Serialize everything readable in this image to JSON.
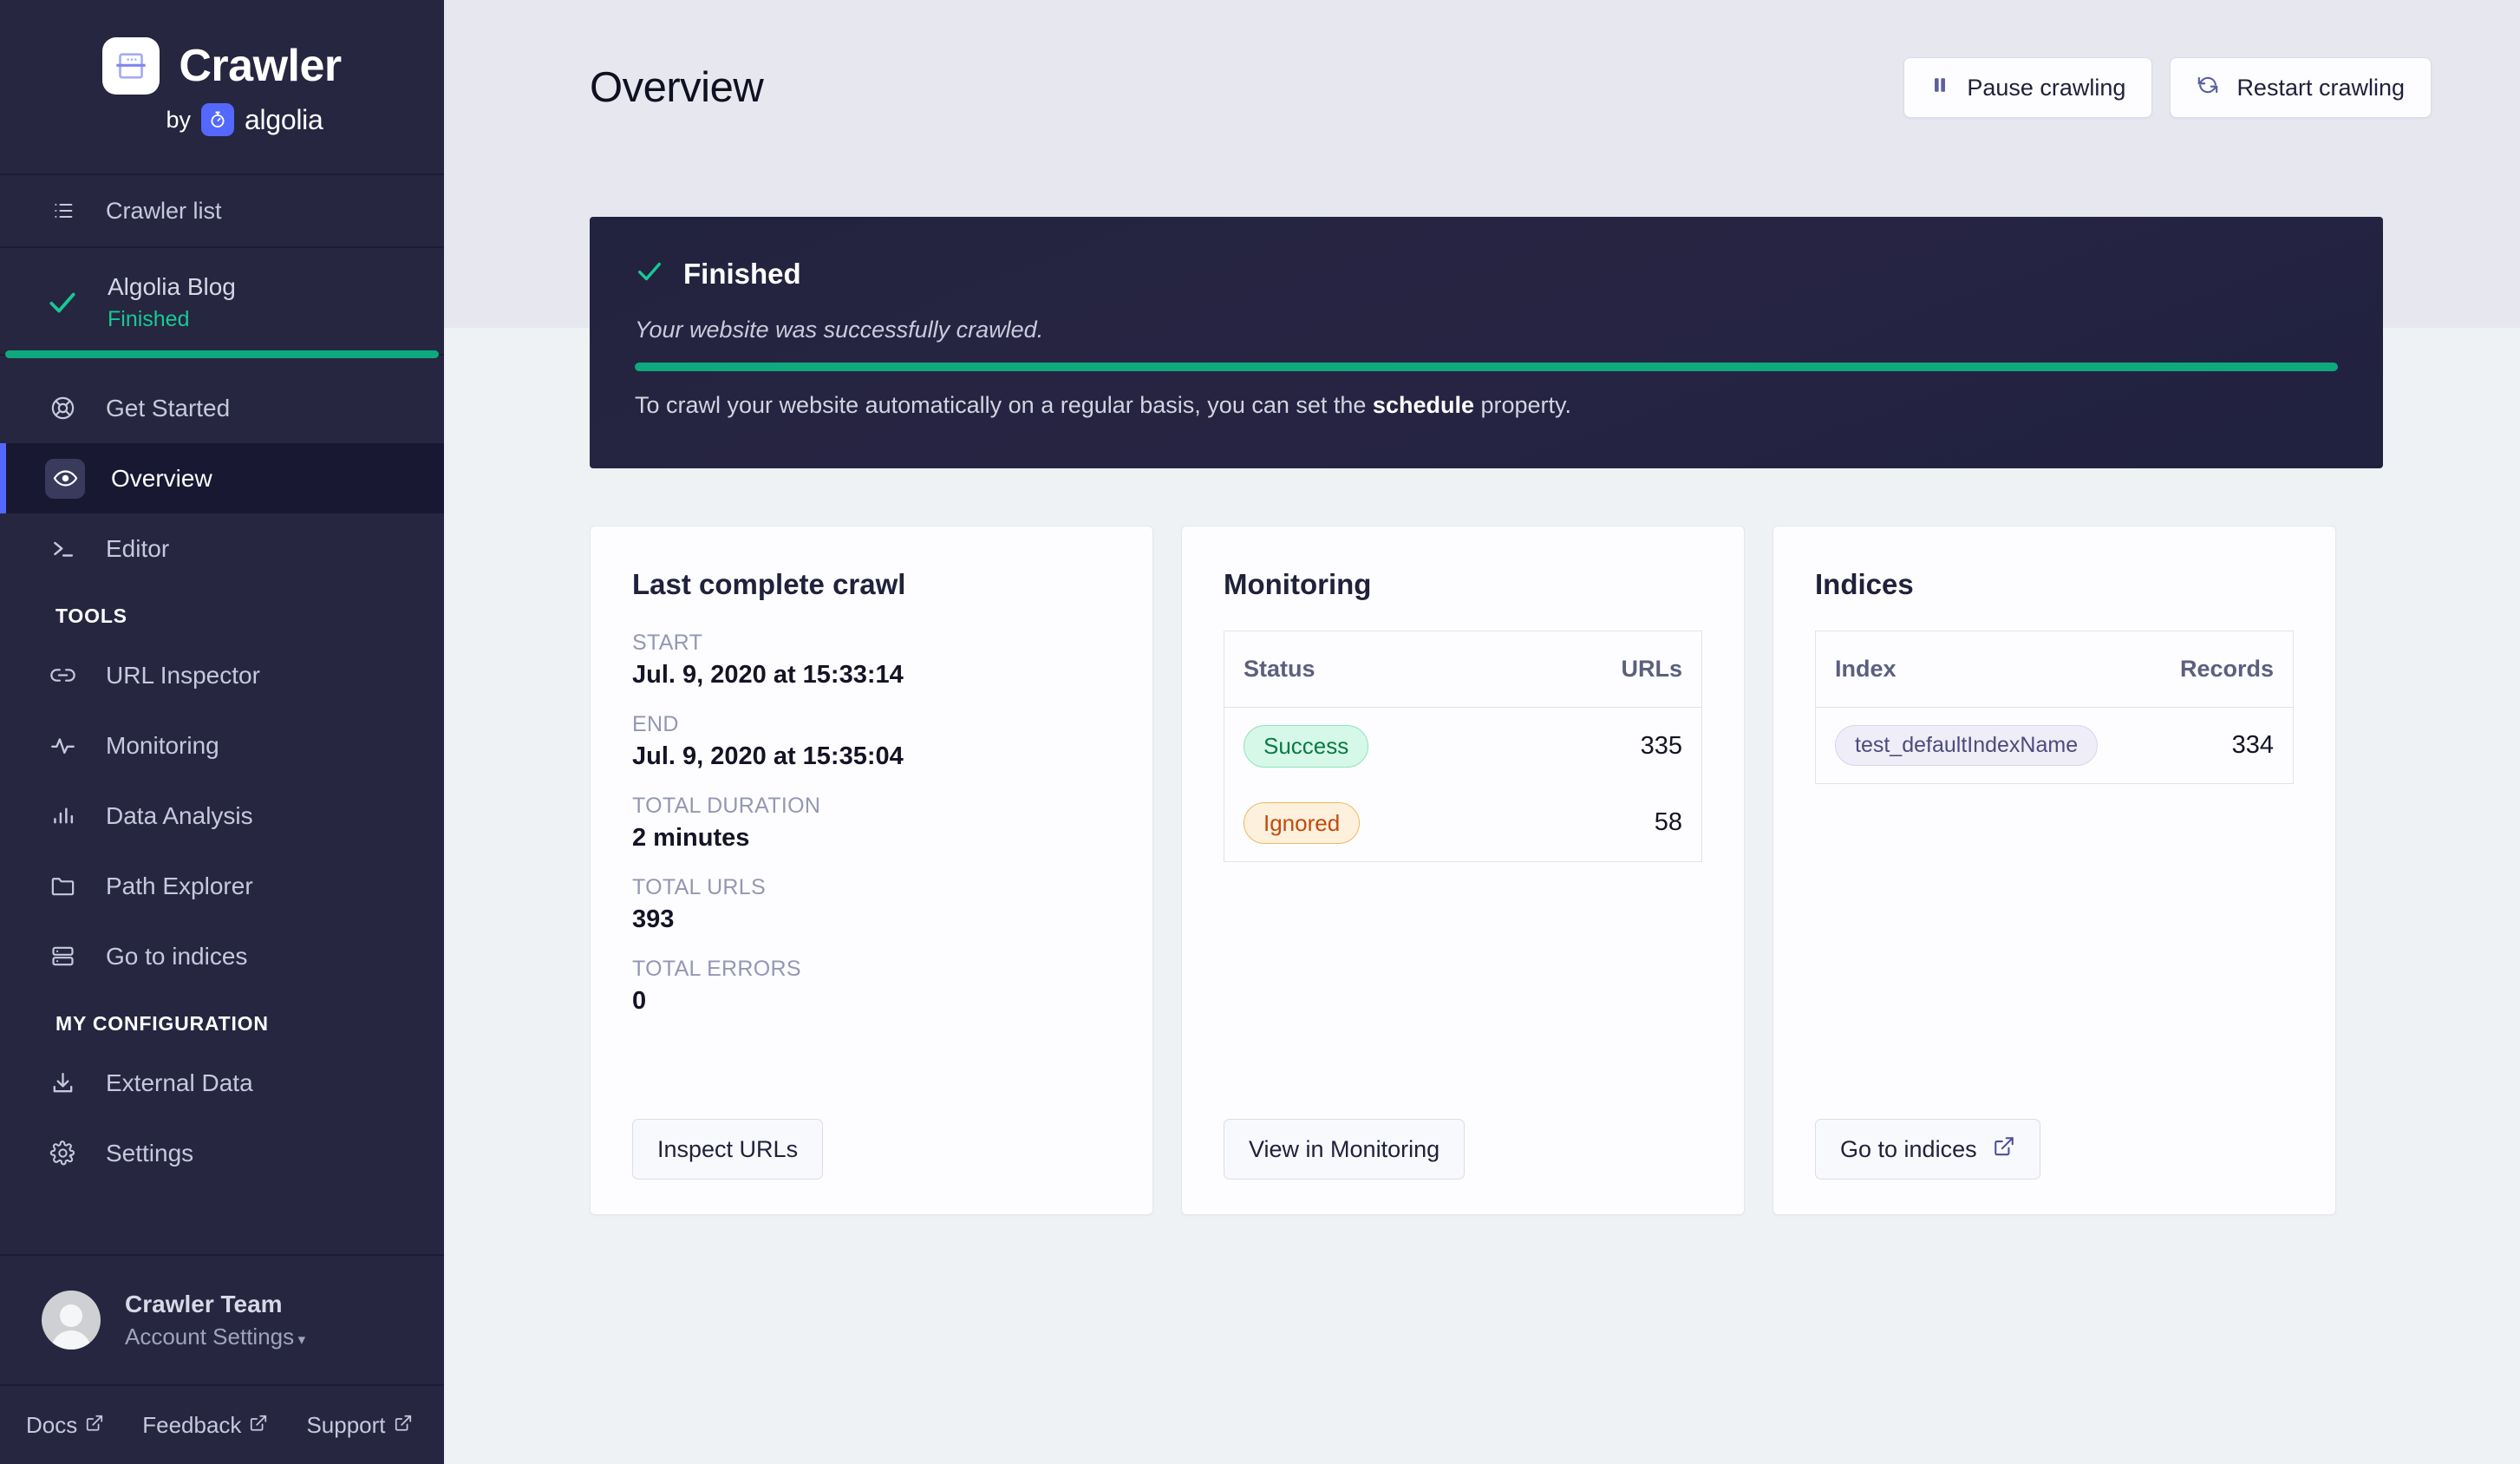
{
  "brand": {
    "name": "Crawler",
    "by": "by",
    "algolia": "algolia",
    "logo_icon": "browser-window-icon",
    "algolia_icon": "algolia-stopwatch-icon"
  },
  "sidebar": {
    "crawler_list": {
      "label": "Crawler list",
      "icon": "list-icon"
    },
    "current_crawler": {
      "title": "Algolia Blog",
      "status": "Finished",
      "check_icon": "check-icon",
      "progress_color": "#0fa97e"
    },
    "menu": [
      {
        "label": "Get Started",
        "icon": "lifebuoy-icon",
        "active": false
      },
      {
        "label": "Overview",
        "icon": "eye-icon",
        "active": true
      },
      {
        "label": "Editor",
        "icon": "terminal-icon",
        "active": false
      }
    ],
    "tools_heading": "TOOLS",
    "tools": [
      {
        "label": "URL Inspector",
        "icon": "link-icon"
      },
      {
        "label": "Monitoring",
        "icon": "activity-icon"
      },
      {
        "label": "Data Analysis",
        "icon": "bar-chart-icon"
      },
      {
        "label": "Path Explorer",
        "icon": "folder-icon"
      },
      {
        "label": "Go to indices",
        "icon": "database-icon"
      }
    ],
    "config_heading": "MY CONFIGURATION",
    "config": [
      {
        "label": "External Data",
        "icon": "download-icon"
      },
      {
        "label": "Settings",
        "icon": "gear-icon"
      }
    ],
    "account": {
      "name": "Crawler Team",
      "settings_label": "Account Settings",
      "caret": "▾",
      "avatar_icon": "avatar-icon"
    },
    "footer_links": [
      {
        "label": "Docs",
        "icon": "external-link-icon"
      },
      {
        "label": "Feedback",
        "icon": "external-link-icon"
      },
      {
        "label": "Support",
        "icon": "external-link-icon"
      }
    ]
  },
  "header": {
    "title": "Overview",
    "pause_button": {
      "label": "Pause crawling",
      "icon": "pause-icon"
    },
    "restart_button": {
      "label": "Restart crawling",
      "icon": "refresh-icon"
    }
  },
  "banner": {
    "status": "Finished",
    "check_icon": "check-icon",
    "message": "Your website was successfully crawled.",
    "note_before": "To crawl your website automatically on a regular basis, you can set the ",
    "note_link": "schedule",
    "note_after": " property.",
    "progress_percent": 100,
    "progress_color": "#0fa97e"
  },
  "cards": {
    "last_crawl": {
      "title": "Last complete crawl",
      "fields": [
        {
          "label": "START",
          "value": "Jul. 9, 2020 at 15:33:14"
        },
        {
          "label": "END",
          "value": "Jul. 9, 2020 at 15:35:04"
        },
        {
          "label": "TOTAL DURATION",
          "value": "2 minutes"
        },
        {
          "label": "TOTAL URLS",
          "value": "393"
        },
        {
          "label": "TOTAL ERRORS",
          "value": "0"
        }
      ],
      "button": {
        "label": "Inspect URLs",
        "icon": null
      }
    },
    "monitoring": {
      "title": "Monitoring",
      "columns": [
        "Status",
        "URLs"
      ],
      "rows": [
        {
          "status": "Success",
          "status_type": "success",
          "urls": "335"
        },
        {
          "status": "Ignored",
          "status_type": "ignored",
          "urls": "58"
        }
      ],
      "button": {
        "label": "View in Monitoring",
        "icon": null
      }
    },
    "indices": {
      "title": "Indices",
      "columns": [
        "Index",
        "Records"
      ],
      "rows": [
        {
          "index": "test_defaultIndexName",
          "records": "334"
        }
      ],
      "button": {
        "label": "Go to indices",
        "icon": "external-link-icon"
      }
    }
  },
  "colors": {
    "sidebar_bg": "#262640",
    "sidebar_active_bg": "#181832",
    "accent_blue": "#5468ff",
    "accent_green": "#0fa97e",
    "status_green_text": "#0a7a44",
    "status_orange_text": "#c24a0d",
    "header_band": "#e7e7f0",
    "page_bg": "#eef2f5"
  }
}
